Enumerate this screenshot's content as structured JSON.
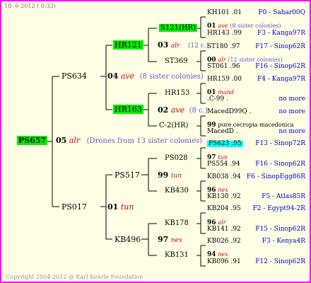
{
  "header": "18-  6-2012 ( 0:33)",
  "copyright": "Copyright 2004-2012 @ Karl Kehrle Foundation",
  "colors": {
    "border": "#ff00ff",
    "background": "#ffffe6",
    "green": "#00ee00",
    "cyan": "#00ffff",
    "year": "#cc0000",
    "sisters": "#6655cc",
    "location": "#0000cc"
  },
  "root": {
    "name": "PS657",
    "num": "05",
    "year": "alr",
    "info": "(Drones from 13 sister colonies)"
  },
  "gen1": {
    "top": {
      "name": "PS634",
      "num": "04",
      "year": "ave",
      "info": "(8 sister colonies)"
    },
    "bottom": {
      "name": "PS017",
      "num": "01",
      "year": "tun"
    }
  },
  "gen2": [
    {
      "name": "HR121",
      "num": "03",
      "year": "alr",
      "info": "(12 c.)"
    },
    {
      "name": "HR163",
      "num": "02",
      "year": "ave",
      "info": "(8 c.)"
    },
    {
      "name": "PS517",
      "num": "99",
      "year": "tun"
    },
    {
      "name": "KB496",
      "num": "97",
      "year": "nex"
    }
  ],
  "gen3": [
    {
      "name": "S121(HR)",
      "num": "03",
      "year": "alr",
      "info": "(12 c.)"
    },
    {
      "name": "ST369"
    },
    {
      "name": "HR153",
      "num": "01",
      "year": "mand"
    },
    {
      "name": "C-2(HR)",
      "num": "99",
      "year": "pure cecropia macedonica"
    },
    {
      "name": "PS028",
      "num": "97",
      "year": "tun"
    },
    {
      "name": "KB430",
      "num": "96",
      "year": "nex"
    },
    {
      "name": "KB178",
      "num": "96",
      "year": "alr"
    },
    {
      "name": "KB131",
      "num": "94",
      "year": "nex"
    }
  ],
  "gen3_between": [
    {
      "num": "01",
      "year": "ave",
      "info": "(8 sister colonies)"
    },
    {
      "num": "00",
      "year": "alr",
      "info": "(12 sister colonies)"
    },
    {
      "num": "01",
      "year": "mand"
    },
    {
      "num": "02",
      "year": "ave",
      "info": "(8 c.)"
    }
  ],
  "leaves": [
    {
      "name": "KH101 .01",
      "loc": "F0 - Sahar00Q"
    },
    {
      "name": "HR143 .99",
      "loc": "F3 - Kanga97R"
    },
    {
      "name": "ST180 .97",
      "loc": "F17 - Sinop62R"
    },
    {
      "name": "ST061 .96",
      "loc": "F16 - Sinop62R"
    },
    {
      "name": "HR159 .00",
      "loc": "F4 - Kanga97R"
    },
    {
      "name": ".C-99 .",
      "loc": "no more"
    },
    {
      "name": "MacedD99Q .",
      "loc": "no more"
    },
    {
      "name": "MacedD .",
      "loc": "no more"
    },
    {
      "name": "PS623 .95",
      "loc": "F13 - Sinop72R"
    },
    {
      "name": "PS554 .94",
      "loc": "F16 - Sinop62R"
    },
    {
      "name": "KB038 .94",
      "loc": "F6 - SinopEgg86R"
    },
    {
      "name": "KB130 .92",
      "loc": "F5 - Atlas85R"
    },
    {
      "name": "KB204 .95",
      "loc": "F2 - Egypt94-2R"
    },
    {
      "name": "KB141 .92",
      "loc": "F15 - Sinop62R"
    },
    {
      "name": "KB026 .92",
      "loc": "F3 - Kenya4R"
    },
    {
      "name": "KB096 .91",
      "loc": "F12 - Sinop62R"
    }
  ]
}
